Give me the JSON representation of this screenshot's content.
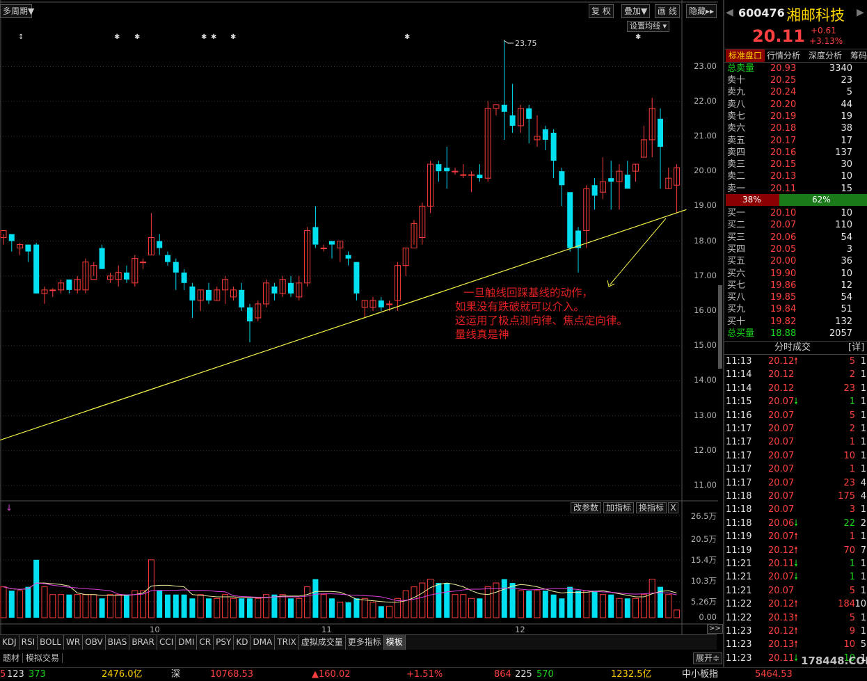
{
  "toolbar": {
    "period": "多周期▼",
    "fq": "复 权",
    "overlay": "叠加▼",
    "draw": "画 线",
    "hide": "隐藏▸▸",
    "ma_setting": "设置均线 ▾"
  },
  "stock": {
    "code": "600476",
    "name": "湘邮科技",
    "price": "20.11",
    "change": "+0.61",
    "pct": "+3.13%"
  },
  "panel_tabs": [
    "标准盘口",
    "行情分析",
    "深度分析",
    "筹码"
  ],
  "depth": {
    "total_sell": {
      "label": "总卖量",
      "price": "20.93",
      "vol": "3340"
    },
    "asks": [
      {
        "label": "卖十",
        "price": "20.25",
        "vol": "23"
      },
      {
        "label": "卖九",
        "price": "20.24",
        "vol": "5"
      },
      {
        "label": "卖八",
        "price": "20.20",
        "vol": "44"
      },
      {
        "label": "卖七",
        "price": "20.19",
        "vol": "19"
      },
      {
        "label": "卖六",
        "price": "20.18",
        "vol": "38"
      },
      {
        "label": "卖五",
        "price": "20.17",
        "vol": "17"
      },
      {
        "label": "卖四",
        "price": "20.16",
        "vol": "137"
      },
      {
        "label": "卖三",
        "price": "20.15",
        "vol": "30"
      },
      {
        "label": "卖二",
        "price": "20.13",
        "vol": "10"
      },
      {
        "label": "卖一",
        "price": "20.11",
        "vol": "15"
      }
    ],
    "ratio_left": "38%",
    "ratio_right": "62%",
    "ratio_fraction": 0.38,
    "bids": [
      {
        "label": "买一",
        "price": "20.10",
        "vol": "10"
      },
      {
        "label": "买二",
        "price": "20.07",
        "vol": "110"
      },
      {
        "label": "买三",
        "price": "20.06",
        "vol": "54"
      },
      {
        "label": "买四",
        "price": "20.05",
        "vol": "3"
      },
      {
        "label": "买五",
        "price": "20.00",
        "vol": "36"
      },
      {
        "label": "买六",
        "price": "19.90",
        "vol": "10"
      },
      {
        "label": "买七",
        "price": "19.86",
        "vol": "12"
      },
      {
        "label": "买八",
        "price": "19.85",
        "vol": "54"
      },
      {
        "label": "买九",
        "price": "19.84",
        "vol": "51"
      },
      {
        "label": "买十",
        "price": "19.82",
        "vol": "132"
      }
    ],
    "total_buy": {
      "label": "总买量",
      "price": "18.88",
      "vol": "2057"
    }
  },
  "trades_title": "分时成交",
  "trades_detail": "[详]",
  "trades": [
    {
      "t": "11:13",
      "p": "20.12",
      "d": "up",
      "v": "5",
      "n": "1"
    },
    {
      "t": "11:14",
      "p": "20.12",
      "d": "",
      "v": "2",
      "n": "1"
    },
    {
      "t": "11:14",
      "p": "20.12",
      "d": "",
      "v": "23",
      "n": "1"
    },
    {
      "t": "11:15",
      "p": "20.07",
      "d": "down",
      "v": "1",
      "n": "1"
    },
    {
      "t": "11:16",
      "p": "20.07",
      "d": "",
      "v": "5",
      "n": "1"
    },
    {
      "t": "11:17",
      "p": "20.07",
      "d": "",
      "v": "2",
      "n": "1"
    },
    {
      "t": "11:17",
      "p": "20.07",
      "d": "",
      "v": "1",
      "n": "1"
    },
    {
      "t": "11:17",
      "p": "20.07",
      "d": "",
      "v": "10",
      "n": "1"
    },
    {
      "t": "11:17",
      "p": "20.07",
      "d": "",
      "v": "1",
      "n": "1"
    },
    {
      "t": "11:17",
      "p": "20.07",
      "d": "",
      "v": "23",
      "n": "4"
    },
    {
      "t": "11:18",
      "p": "20.07",
      "d": "",
      "v": "175",
      "n": "4"
    },
    {
      "t": "11:18",
      "p": "20.07",
      "d": "",
      "v": "3",
      "n": "1"
    },
    {
      "t": "11:18",
      "p": "20.06",
      "d": "down",
      "v": "22",
      "n": "2"
    },
    {
      "t": "11:19",
      "p": "20.07",
      "d": "up",
      "v": "1",
      "n": "1"
    },
    {
      "t": "11:19",
      "p": "20.12",
      "d": "up",
      "v": "70",
      "n": "7"
    },
    {
      "t": "11:21",
      "p": "20.11",
      "d": "down",
      "v": "1",
      "n": "1"
    },
    {
      "t": "11:21",
      "p": "20.07",
      "d": "down",
      "v": "1",
      "n": "1"
    },
    {
      "t": "11:21",
      "p": "20.07",
      "d": "",
      "v": "5",
      "n": "1"
    },
    {
      "t": "11:22",
      "p": "20.12",
      "d": "up",
      "v": "184",
      "n": "10"
    },
    {
      "t": "11:22",
      "p": "20.13",
      "d": "up",
      "v": "5",
      "n": "1"
    },
    {
      "t": "11:23",
      "p": "20.12",
      "d": "up",
      "v": "9",
      "n": "1"
    },
    {
      "t": "11:23",
      "p": "20.13",
      "d": "up",
      "v": "10",
      "n": "5"
    },
    {
      "t": "11:23",
      "p": "20.11",
      "d": "down",
      "v": "10",
      "n": "1"
    }
  ],
  "price_ticks": [
    "23.00",
    "22.00",
    "21.00",
    "20.00",
    "19.00",
    "18.00",
    "17.00",
    "16.00",
    "15.00",
    "14.00",
    "13.00",
    "12.00",
    "11.00"
  ],
  "vol_ticks": [
    "26.5万",
    "20.5万",
    "15.4万",
    "10.3万",
    "5.26万",
    "0.00"
  ],
  "month_labels": [
    "10",
    "11",
    "12"
  ],
  "high_label": "23.75",
  "annotation": [
    "一旦触线回踩基线的动作，",
    "如果没有跌破就可以介入。",
    "这运用了极点测向律、焦点定向律。",
    "量线真是神"
  ],
  "indicator_buttons": {
    "param": "改参数",
    "add": "加指标",
    "swap": "换指标",
    "close": "X"
  },
  "indicator_tabs": [
    "KDJ",
    "RSI",
    "BOLL",
    "WR",
    "OBV",
    "BIAS",
    "BRAR",
    "CCI",
    "DMI",
    "CR",
    "PSY",
    "KD",
    "DMA",
    "TRIX",
    "虚拟成交量",
    "更多指标",
    "模板"
  ],
  "subtabs": [
    "题材",
    "模拟交易"
  ],
  "expand": "展开≑",
  "status": {
    "s1": "5",
    "s2": "123",
    "s3": "373",
    "amt1": "2476.0亿",
    "shen": "深",
    "idx1": "10768.53",
    "chg1": "▲160.02",
    "pct1": "+1.51%",
    "c1": "864",
    "c2": "225",
    "c3": "570",
    "amt2": "1232.5亿",
    "idx2name": "中小板指",
    "idx2": "5464.53"
  },
  "watermark": "178448.COM",
  "chart_data": {
    "type": "candlestick",
    "ylim": [
      10.5,
      23.95
    ],
    "candles": [
      [
        18.1,
        18.3,
        17.9,
        18.2
      ],
      [
        18.2,
        18.0,
        17.7,
        18.1
      ],
      [
        17.8,
        17.9,
        17.6,
        17.95
      ],
      [
        17.9,
        17.7,
        17.4,
        17.85
      ],
      [
        17.9,
        16.5,
        16.5,
        17.95
      ],
      [
        16.5,
        16.6,
        16.2,
        16.7
      ],
      [
        16.6,
        16.6,
        16.4,
        16.65
      ],
      [
        16.6,
        16.8,
        16.5,
        16.9
      ],
      [
        16.9,
        16.6,
        16.5,
        16.9
      ],
      [
        16.6,
        16.9,
        16.5,
        17.0
      ],
      [
        16.6,
        17.4,
        16.5,
        17.5
      ],
      [
        16.9,
        17.3,
        17.0,
        17.4
      ],
      [
        17.8,
        17.2,
        17.2,
        17.9
      ],
      [
        16.9,
        17.0,
        16.8,
        17.1
      ],
      [
        16.9,
        17.1,
        16.7,
        17.3
      ],
      [
        17.1,
        16.9,
        16.8,
        17.3
      ],
      [
        16.8,
        17.5,
        16.7,
        17.6
      ],
      [
        17.4,
        17.4,
        17.2,
        17.5
      ],
      [
        17.6,
        18.1,
        17.6,
        18.8
      ],
      [
        18.0,
        17.8,
        17.6,
        18.2
      ],
      [
        17.6,
        17.4,
        17.3,
        17.7
      ],
      [
        17.4,
        17.1,
        16.6,
        17.5
      ],
      [
        17.1,
        16.8,
        16.6,
        17.2
      ],
      [
        16.7,
        16.3,
        15.8,
        16.8
      ],
      [
        16.3,
        16.6,
        16.0,
        16.6
      ],
      [
        16.6,
        16.3,
        16.2,
        16.8
      ],
      [
        16.3,
        16.6,
        16.3,
        16.7
      ],
      [
        16.6,
        16.9,
        16.2,
        17.0
      ],
      [
        16.4,
        16.6,
        16.3,
        16.7
      ],
      [
        16.6,
        16.1,
        16.0,
        16.8
      ],
      [
        16.1,
        15.7,
        15.1,
        16.2
      ],
      [
        15.8,
        16.2,
        15.7,
        16.3
      ],
      [
        16.2,
        16.8,
        16.1,
        16.9
      ],
      [
        16.7,
        16.5,
        16.3,
        16.8
      ],
      [
        16.5,
        16.9,
        16.4,
        17.0
      ],
      [
        16.8,
        16.5,
        16.4,
        17.0
      ],
      [
        16.4,
        16.8,
        16.3,
        17.0
      ],
      [
        16.8,
        18.3,
        16.7,
        18.4
      ],
      [
        18.4,
        17.9,
        17.8,
        19.0
      ],
      [
        17.8,
        17.8,
        17.7,
        17.9
      ],
      [
        18.0,
        17.9,
        17.5,
        18.0
      ],
      [
        17.8,
        18.0,
        17.4,
        18.0
      ],
      [
        17.6,
        17.5,
        17.3,
        17.7
      ],
      [
        17.4,
        16.5,
        16.3,
        17.4
      ],
      [
        16.1,
        16.3,
        15.8,
        16.3
      ],
      [
        16.1,
        16.3,
        16.0,
        16.4
      ],
      [
        16.3,
        16.1,
        16.0,
        16.4
      ],
      [
        16.2,
        16.2,
        16.0,
        16.3
      ],
      [
        16.3,
        17.3,
        16.0,
        17.4
      ],
      [
        17.3,
        17.8,
        17.0,
        17.8
      ],
      [
        17.8,
        18.5,
        17.9,
        18.6
      ],
      [
        18.1,
        19.0,
        17.9,
        19.1
      ],
      [
        19.0,
        20.2,
        18.8,
        20.3
      ],
      [
        20.2,
        20.0,
        19.7,
        20.3
      ],
      [
        20.1,
        20.0,
        19.5,
        20.7
      ],
      [
        20.0,
        20.0,
        19.9,
        20.1
      ],
      [
        19.9,
        19.9,
        19.8,
        20.2
      ],
      [
        19.9,
        19.9,
        19.4,
        20.0
      ],
      [
        19.9,
        19.8,
        19.7,
        20.2
      ],
      [
        19.8,
        21.8,
        19.7,
        22.0
      ],
      [
        21.8,
        21.9,
        21.6,
        21.8
      ],
      [
        21.9,
        21.7,
        20.9,
        23.75
      ],
      [
        21.6,
        21.3,
        21.1,
        22.5
      ],
      [
        21.3,
        21.8,
        21.1,
        21.9
      ],
      [
        21.8,
        21.5,
        20.8,
        21.9
      ],
      [
        20.9,
        21.0,
        20.7,
        21.6
      ],
      [
        21.2,
        20.9,
        20.6,
        21.3
      ],
      [
        21.1,
        20.3,
        19.8,
        21.2
      ],
      [
        20.0,
        19.6,
        19.0,
        20.1
      ],
      [
        19.4,
        17.8,
        17.7,
        19.4
      ],
      [
        18.3,
        17.8,
        17.1,
        18.4
      ],
      [
        18.3,
        19.5,
        17.8,
        19.6
      ],
      [
        19.6,
        19.3,
        18.9,
        19.8
      ],
      [
        19.4,
        19.7,
        19.2,
        20.4
      ],
      [
        19.8,
        19.7,
        18.9,
        20.3
      ],
      [
        19.7,
        20.0,
        18.9,
        20.2
      ],
      [
        19.9,
        19.5,
        19.5,
        20.3
      ],
      [
        20.0,
        20.2,
        19.7,
        20.2
      ],
      [
        20.4,
        20.9,
        20.4,
        21.3
      ],
      [
        20.9,
        21.8,
        20.4,
        22.1
      ],
      [
        21.5,
        20.7,
        19.5,
        21.8
      ],
      [
        19.5,
        19.8,
        19.5,
        20.1
      ],
      [
        19.6,
        20.1,
        18.8,
        20.2
      ]
    ],
    "volumes": [
      8,
      7,
      7,
      8,
      15,
      8,
      6,
      6,
      6,
      6,
      6,
      6,
      5,
      6,
      6,
      6,
      7,
      7,
      15,
      7,
      6,
      6,
      6,
      5,
      6,
      5,
      5,
      6,
      5,
      5,
      5,
      5,
      6,
      6,
      6,
      5,
      5,
      8,
      10,
      6,
      5,
      4,
      4,
      5,
      5,
      4,
      3,
      3,
      5,
      7,
      8,
      9,
      10,
      9,
      9,
      6,
      6,
      5,
      5,
      8,
      9,
      10,
      9,
      7,
      7,
      7,
      7,
      6,
      5,
      8,
      7,
      7,
      7,
      6,
      6,
      5,
      5,
      5,
      6,
      10,
      8,
      6,
      2
    ],
    "trendline": [
      [
        0,
        12.3
      ],
      [
        83,
        18.9
      ]
    ]
  }
}
